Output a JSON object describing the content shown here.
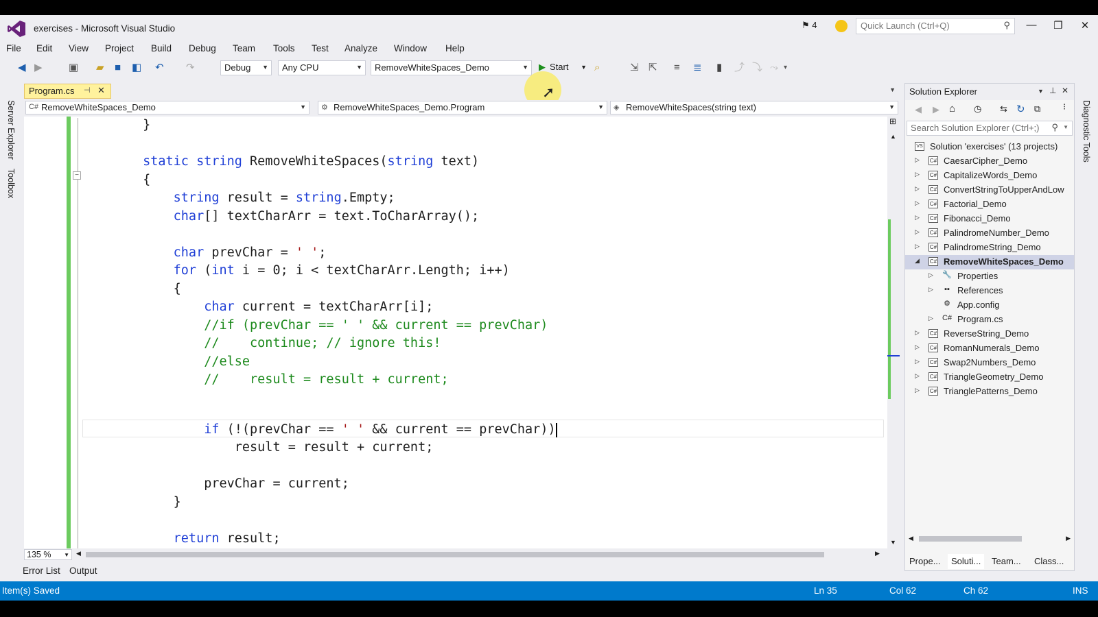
{
  "window": {
    "title": "exercises - Microsoft Visual Studio",
    "notification_count": "4",
    "quick_launch_placeholder": "Quick Launch (Ctrl+Q)"
  },
  "menu": [
    "File",
    "Edit",
    "View",
    "Project",
    "Build",
    "Debug",
    "Team",
    "Tools",
    "Test",
    "Analyze",
    "Window",
    "Help"
  ],
  "toolbar": {
    "configuration": "Debug",
    "platform": "Any CPU",
    "startup_project": "RemoveWhiteSpaces_Demo",
    "start_label": "Start"
  },
  "left_strip": [
    "Server Explorer",
    "Toolbox"
  ],
  "right_strip": [
    "Diagnostic Tools"
  ],
  "editor": {
    "tab": "Program.cs",
    "nav": {
      "project": "RemoveWhiteSpaces_Demo",
      "class": "RemoveWhiteSpaces_Demo.Program",
      "member": "RemoveWhiteSpaces(string text)"
    },
    "zoom": "135 %",
    "lines": [
      "        }",
      "",
      "        static string RemoveWhiteSpaces(string text)",
      "        {",
      "            string result = string.Empty;",
      "            char[] textCharArr = text.ToCharArray();",
      "",
      "            char prevChar = ' ';",
      "            for (int i = 0; i < textCharArr.Length; i++)",
      "            {",
      "                char current = textCharArr[i];",
      "                //if (prevChar == ' ' && current == prevChar)",
      "                //    continue; // ignore this!",
      "                //else",
      "                //    result = result + current;",
      "",
      "                if (!(prevChar == ' ' && current == prevChar))",
      "                    result = result + current;",
      "",
      "                prevChar = current;",
      "            }",
      "",
      "            return result;"
    ]
  },
  "solution_explorer": {
    "title": "Solution Explorer",
    "search_placeholder": "Search Solution Explorer (Ctrl+;)",
    "solution": "Solution 'exercises' (13 projects)",
    "items": [
      {
        "label": "CaesarCipher_Demo",
        "level": 1,
        "expander": "collapsed",
        "icon": "csharp-project-icon"
      },
      {
        "label": "CapitalizeWords_Demo",
        "level": 1,
        "expander": "collapsed",
        "icon": "csharp-project-icon"
      },
      {
        "label": "ConvertStringToUpperAndLow",
        "level": 1,
        "expander": "collapsed",
        "icon": "csharp-project-icon"
      },
      {
        "label": "Factorial_Demo",
        "level": 1,
        "expander": "collapsed",
        "icon": "csharp-project-icon"
      },
      {
        "label": "Fibonacci_Demo",
        "level": 1,
        "expander": "collapsed",
        "icon": "csharp-project-icon"
      },
      {
        "label": "PalindromeNumber_Demo",
        "level": 1,
        "expander": "collapsed",
        "icon": "csharp-project-icon"
      },
      {
        "label": "PalindromeString_Demo",
        "level": 1,
        "expander": "collapsed",
        "icon": "csharp-project-icon"
      },
      {
        "label": "RemoveWhiteSpaces_Demo",
        "level": 1,
        "expander": "expanded",
        "icon": "csharp-project-icon",
        "selected": true,
        "bold": true
      },
      {
        "label": "Properties",
        "level": 2,
        "expander": "collapsed",
        "icon": "wrench-icon"
      },
      {
        "label": "References",
        "level": 2,
        "expander": "collapsed",
        "icon": "references-icon"
      },
      {
        "label": "App.config",
        "level": 2,
        "expander": "none",
        "icon": "config-file-icon"
      },
      {
        "label": "Program.cs",
        "level": 2,
        "expander": "collapsed",
        "icon": "csharp-file-icon"
      },
      {
        "label": "ReverseString_Demo",
        "level": 1,
        "expander": "collapsed",
        "icon": "csharp-project-icon"
      },
      {
        "label": "RomanNumerals_Demo",
        "level": 1,
        "expander": "collapsed",
        "icon": "csharp-project-icon"
      },
      {
        "label": "Swap2Numbers_Demo",
        "level": 1,
        "expander": "collapsed",
        "icon": "csharp-project-icon"
      },
      {
        "label": "TriangleGeometry_Demo",
        "level": 1,
        "expander": "collapsed",
        "icon": "csharp-project-icon"
      },
      {
        "label": "TrianglePatterns_Demo",
        "level": 1,
        "expander": "collapsed",
        "icon": "csharp-project-icon"
      }
    ],
    "bottom_tabs": [
      "Prope...",
      "Soluti...",
      "Team...",
      "Class..."
    ],
    "active_bottom_tab": "Soluti..."
  },
  "bottom_panel_tabs": [
    "Error List",
    "Output"
  ],
  "status": {
    "message": "Item(s) Saved",
    "line": "Ln 35",
    "col": "Col 62",
    "ch": "Ch 62",
    "mode": "INS"
  },
  "colors": {
    "status_bar": "#007acc",
    "keyword": "#1f3fd6",
    "comment": "#1d8a1d",
    "string": "#a31515",
    "tab_active": "#fff29d",
    "change_margin": "#6ccb5f"
  }
}
